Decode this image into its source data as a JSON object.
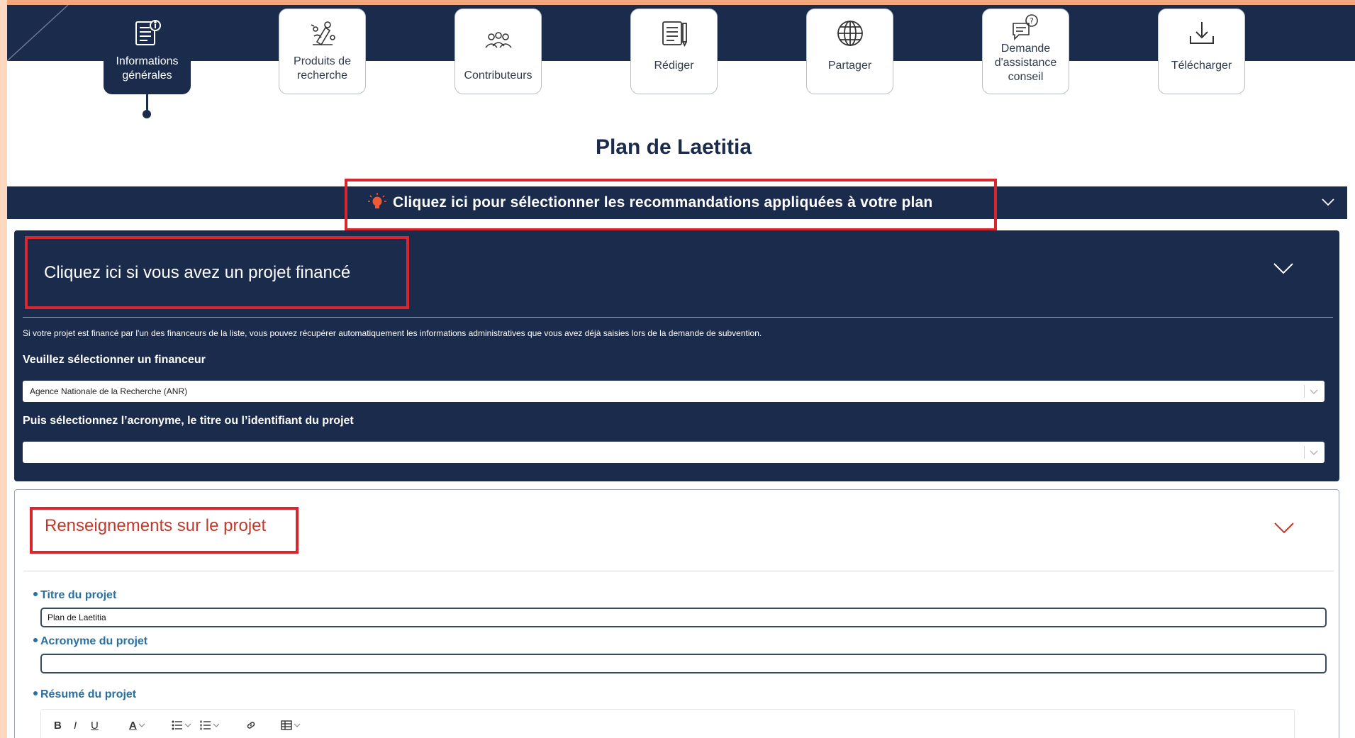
{
  "nav": {
    "steps": [
      {
        "label": "Informations\ngénérales",
        "icon": "document-info-icon",
        "active": true
      },
      {
        "label": "Produits de\nrecherche",
        "icon": "research-products-icon",
        "active": false
      },
      {
        "label": "Contributeurs",
        "icon": "contributors-icon",
        "active": false
      },
      {
        "label": "Rédiger",
        "icon": "write-icon",
        "active": false
      },
      {
        "label": "Partager",
        "icon": "globe-share-icon",
        "active": false
      },
      {
        "label": "Demande\nd'assistance\nconseil",
        "icon": "assistance-request-icon",
        "active": false
      },
      {
        "label": "Télécharger",
        "icon": "download-icon",
        "active": false
      }
    ]
  },
  "plan": {
    "title": "Plan de Laetitia"
  },
  "recommendations": {
    "label": "Cliquez ici pour sélectionner les recommandations appliquées à votre plan"
  },
  "funded": {
    "title": "Cliquez ici si vous avez un projet financé",
    "description": "Si votre projet est financé par l'un des financeurs de la liste, vous pouvez récupérer automatiquement les informations administratives que vous avez déjà saisies lors de la demande de subvention.",
    "funder_label": "Veuillez sélectionner un financeur",
    "funder_value": "Agence Nationale de la Recherche (ANR)",
    "project_label": "Puis sélectionnez l’acronyme, le titre ou l’identifiant du projet",
    "project_value": ""
  },
  "project": {
    "section_title": "Renseignements sur le projet",
    "title_label": "Titre du projet",
    "title_value": "Plan de Laetitia",
    "acronym_label": "Acronyme du projet",
    "acronym_value": "",
    "summary_label": "Résumé du projet",
    "toolbar": {
      "bold": "B",
      "italic": "I",
      "underline": "U",
      "font_color": "A"
    }
  },
  "colors": {
    "navy": "#1a2b4c",
    "highlight_red": "#d7262e",
    "section_red": "#c0392b",
    "label_blue": "#2b6f9e"
  }
}
